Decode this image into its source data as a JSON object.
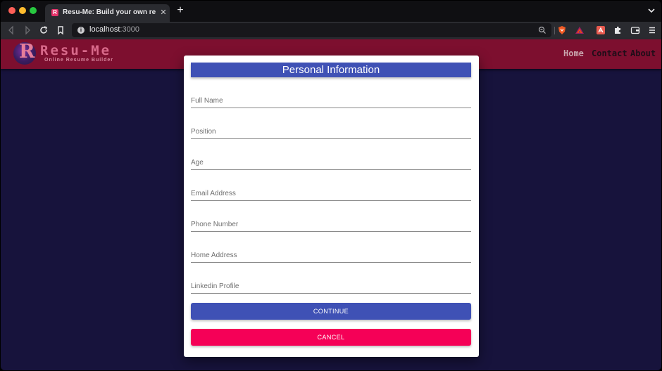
{
  "browser": {
    "tab_title": "Resu-Me: Build your own resume",
    "tab_favicon": "R",
    "tab_close": "✕",
    "new_tab": "+",
    "url_host": "localhost",
    "url_port": ":3000",
    "url_info": "i"
  },
  "site": {
    "logo_letter": "R",
    "logo_title": "Resu-Me",
    "logo_tagline": "Online Resume Builder",
    "nav": [
      "Home",
      "Contact",
      "About"
    ]
  },
  "form": {
    "title": "Personal Information",
    "fields": [
      {
        "placeholder": "Full Name",
        "value": ""
      },
      {
        "placeholder": "Position",
        "value": ""
      },
      {
        "placeholder": "Age",
        "value": ""
      },
      {
        "placeholder": "Email Address",
        "value": ""
      },
      {
        "placeholder": "Phone Number",
        "value": ""
      },
      {
        "placeholder": "Home Address",
        "value": ""
      },
      {
        "placeholder": "Linkedin Profile",
        "value": ""
      }
    ],
    "continue_label": "CONTINUE",
    "cancel_label": "CANCEL"
  },
  "colors": {
    "header": "#7d0f2f",
    "primary": "#3f51b5",
    "secondary": "#f50057",
    "background": "#17133c"
  }
}
